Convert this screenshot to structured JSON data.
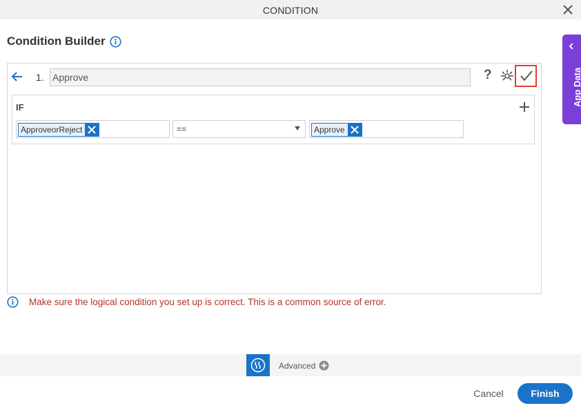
{
  "dialog": {
    "title": "CONDITION"
  },
  "builder": {
    "title": "Condition Builder"
  },
  "condition": {
    "number": "1.",
    "name": "Approve",
    "help_label": "?",
    "if_label": "IF",
    "left_operand": "ApproveorReject",
    "operator": "==",
    "right_operand": "Approve"
  },
  "warning": {
    "text": "Make sure the logical condition you set up is correct. This is a common source of error."
  },
  "advanced": {
    "label": "Advanced"
  },
  "footer": {
    "cancel_label": "Cancel",
    "finish_label": "Finish"
  },
  "side_tab": {
    "label": "App Data"
  },
  "colors": {
    "accent": "#1a73c9",
    "side_tab": "#7a3fd6",
    "warning_text": "#b3332a",
    "highlight": "#e53935"
  },
  "icons": {
    "close": "close-icon",
    "info": "info-icon",
    "back": "arrow-left-icon",
    "debug": "bug-icon",
    "apply": "checkmark-icon",
    "add": "plus-icon",
    "remove_token": "close-icon",
    "dropdown": "caret-down-icon",
    "advanced": "advanced-icon",
    "expand": "plus-circle-icon",
    "side_tab": "chevron-left-icon"
  }
}
